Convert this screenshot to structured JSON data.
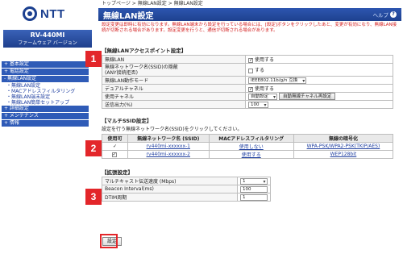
{
  "logo_text": "NTT",
  "model": {
    "name": "RV-440MI",
    "firmware_label": "ファームウェア バージョン"
  },
  "menu": [
    {
      "label": "+ 基本設定"
    },
    {
      "label": "+ 電話設定"
    },
    {
      "label": "- 無線LAN設定"
    },
    {
      "label": "+ 詳細設定"
    },
    {
      "label": "+ メンテナンス"
    },
    {
      "label": "+ 情報"
    }
  ],
  "submenu": [
    "・無線LAN設定",
    "・MACアドレスフィルタリング",
    "・無線LAN端末設定",
    "・無線LAN簡単セットアップ"
  ],
  "breadcrumb": "トップページ > 無線LAN設定 > 無線LAN設定",
  "title": "無線LAN設定",
  "help_label": "ヘルプ",
  "description": "設定変更は即時に有効になります。無線LAN端末から設定を行っている場合には、[設定]ボタンをクリックしたあと、変更が有効になり、無線LAN接続が切断される場合があります。設定変更を行うと、通信が切断される場合があります。",
  "sections": {
    "ap": {
      "title": "【無線LANアクセスポイント設定】",
      "rows": {
        "wlan": {
          "label": "無線LAN",
          "value": "使用する",
          "checked": true
        },
        "stealth": {
          "label": "無線ネットワーク名(SSID)の隠蔽\n(ANY接続拒否)",
          "value": "する",
          "checked": false
        },
        "mode": {
          "label": "無線LAN動作モード",
          "value": "IEEE802.11b/g/n 互換"
        },
        "dual": {
          "label": "デュアルチャネル",
          "value": "使用する",
          "checked": true
        },
        "channel": {
          "label": "使用チャネル",
          "value": "自動設定",
          "button": "自動無線チャネル再設定"
        },
        "power": {
          "label": "送信出力(%)",
          "value": "100"
        }
      }
    },
    "ssid": {
      "title": "【マルチSSID設定】",
      "note": "設定を行う無線ネットワーク名(SSID)をクリックしてください。",
      "headers": [
        "使用可",
        "無線ネットワーク名 (SSID)",
        "MACアドレスフィルタリング",
        "無線の暗号化"
      ],
      "rows": [
        {
          "checked": true,
          "ssid": "rv440mi-xxxxxx-1",
          "mac": "使用しない",
          "enc": "WPA-PSK/WPA2-PSK(TKIP/AES)"
        },
        {
          "checked": true,
          "ssid": "rv440mi-xxxxxx-2",
          "mac": "使用する",
          "enc": "WEP128bit"
        }
      ]
    },
    "ext": {
      "title": "【拡張設定】",
      "rows": {
        "multicast": {
          "label": "マルチキャスト伝送速度 (Mbps)",
          "value": "1"
        },
        "beacon": {
          "label": "Beacon Interval(ms)",
          "value": "100"
        },
        "dtim": {
          "label": "DTIM周期",
          "value": "1"
        }
      }
    }
  },
  "submit_label": "設定",
  "markers": [
    "1",
    "2",
    "3"
  ],
  "colors": {
    "accent": "#2f5bb7",
    "marker": "#e3262a",
    "warning_text": "#d42020",
    "link": "#1f3fa0"
  }
}
